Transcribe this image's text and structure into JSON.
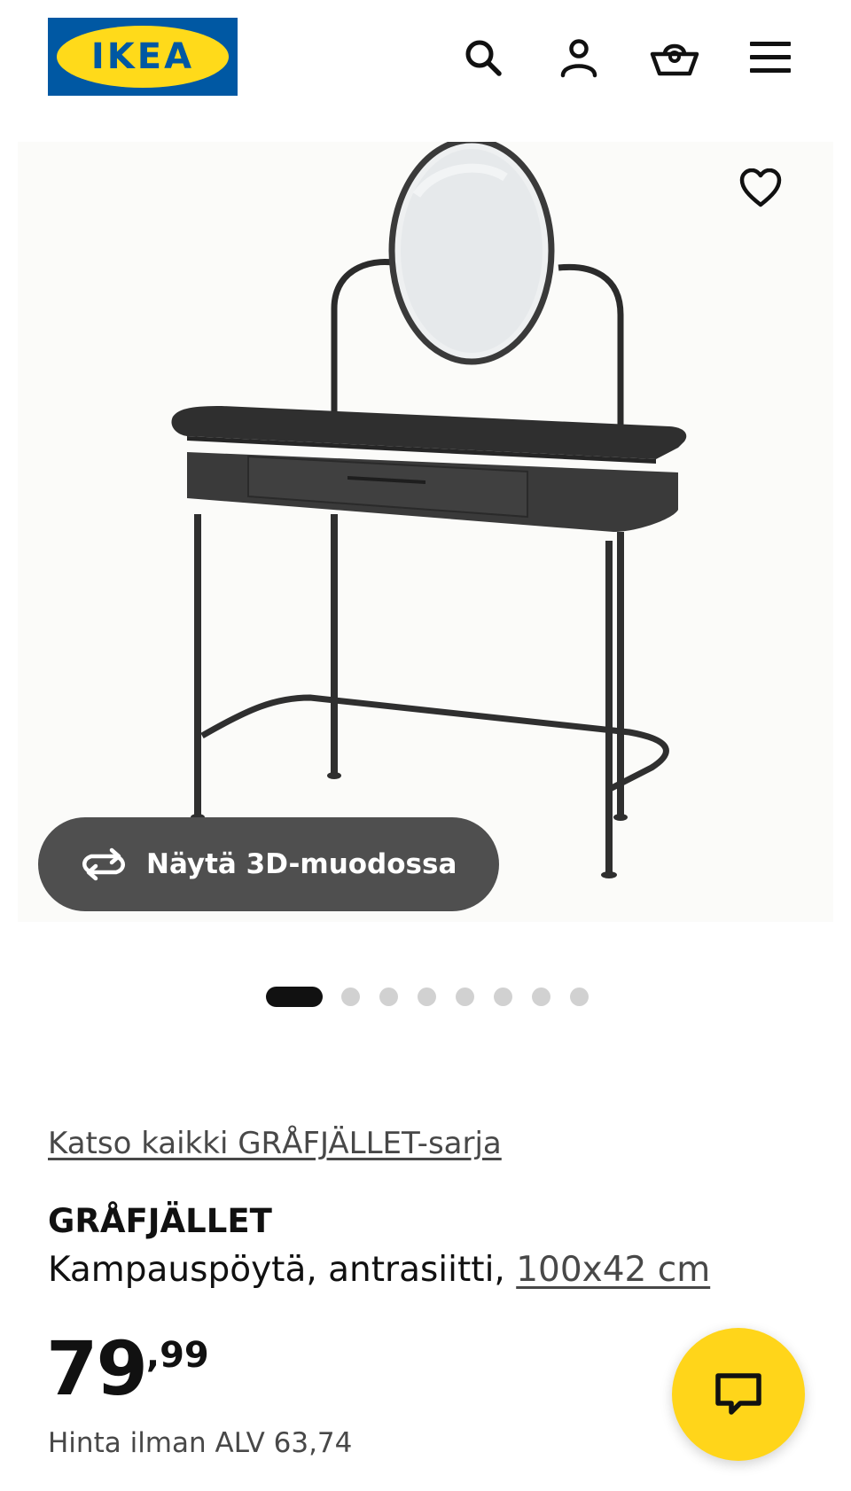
{
  "header": {
    "logo_text": "IKEA",
    "icons": [
      "search-icon",
      "user-icon",
      "shopping-basket-icon",
      "menu-icon"
    ]
  },
  "gallery": {
    "favorite_icon": "heart-icon",
    "view_3d_label": "Näytä 3D-muodossa",
    "view_3d_icon": "rotate-icon",
    "dots_total": 8,
    "active_dot": 1
  },
  "product": {
    "series_link": "Katso kaikki GRÅFJÄLLET-sarja",
    "name": "GRÅFJÄLLET",
    "description": "Kampauspöytä, antrasiitti,",
    "size_link": "100x42 cm",
    "price_integer": "79",
    "price_decimal": ",99",
    "vat_text": "Hinta ilman ALV 63,74"
  },
  "chat": {
    "icon": "chat-bubble-icon"
  },
  "colors": {
    "brand_blue": "#0058a3",
    "brand_yellow": "#ffda1a",
    "chat_yellow": "#ffd51a",
    "button_dark": "#4f4f4f",
    "product_color": "#3a3a3a"
  }
}
